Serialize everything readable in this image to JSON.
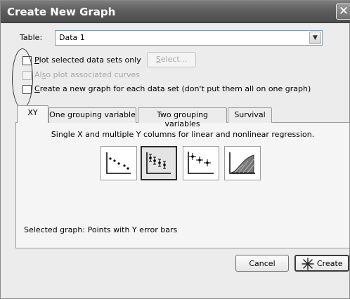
{
  "window": {
    "title": "Create New Graph",
    "close_glyph": "✕"
  },
  "table_row": {
    "label": "Table:",
    "value": "Data 1",
    "dropdown_glyph": "▼"
  },
  "options": [
    {
      "prefix": "",
      "mnemonic": "P",
      "rest": "lot selected data sets only",
      "checked": false,
      "enabled": true
    },
    {
      "prefix": "Al",
      "mnemonic": "s",
      "rest": "o plot associated curves",
      "checked": false,
      "enabled": false
    },
    {
      "prefix": "",
      "mnemonic": "C",
      "rest": "reate a new graph for each data set (don't put them all on one graph)",
      "checked": false,
      "enabled": true
    }
  ],
  "select_button": {
    "mnemonic": "S",
    "rest": "elect...",
    "enabled": false
  },
  "tabs": [
    {
      "label": "XY",
      "active": true
    },
    {
      "label": "One grouping variable",
      "active": false
    },
    {
      "label": "Two grouping variables",
      "active": false
    },
    {
      "label": "Survival",
      "active": false
    }
  ],
  "tab_description": "Single X and multiple Y columns for linear and nonlinear regression.",
  "graph_types": [
    {
      "icon": "points-icon",
      "selected": false
    },
    {
      "icon": "points-with-error-bars-icon",
      "selected": true
    },
    {
      "icon": "points-with-xy-error-bars-icon",
      "selected": false
    },
    {
      "icon": "area-fill-icon",
      "selected": false
    }
  ],
  "selected_graph": {
    "label": "Selected graph:",
    "value": "Points with Y error bars"
  },
  "buttons": {
    "cancel": "Cancel",
    "create": "Create",
    "create_icon": "graph-wizard-icon"
  }
}
